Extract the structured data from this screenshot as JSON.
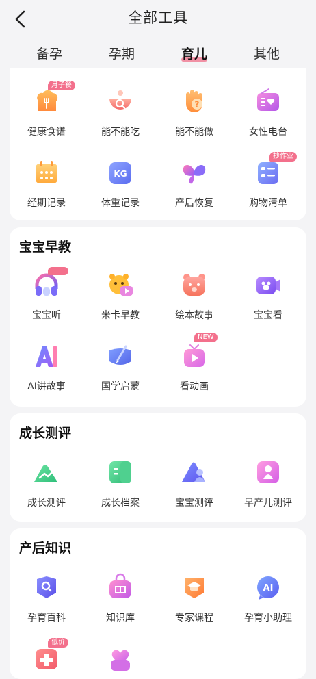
{
  "header": {
    "title": "全部工具"
  },
  "tabs": [
    {
      "label": "备孕"
    },
    {
      "label": "孕期"
    },
    {
      "label": "育儿"
    },
    {
      "label": "其他"
    }
  ],
  "sections": [
    {
      "title": "",
      "items": [
        {
          "label": "健康食谱",
          "icon": "chef-hat-icon",
          "badge": "月子餐"
        },
        {
          "label": "能不能吃",
          "icon": "food-bowl-search-icon"
        },
        {
          "label": "能不能做",
          "icon": "hand-question-icon"
        },
        {
          "label": "女性电台",
          "icon": "radio-heart-icon"
        },
        {
          "label": "经期记录",
          "icon": "calendar-icon"
        },
        {
          "label": "体重记录",
          "icon": "scale-kg-icon",
          "icon_text": "KG"
        },
        {
          "label": "产后恢复",
          "icon": "butterfly-icon"
        },
        {
          "label": "购物清单",
          "icon": "checklist-icon",
          "badge": "抄作业"
        }
      ]
    },
    {
      "title": "宝宝早教",
      "items": [
        {
          "label": "宝宝听",
          "icon": "headphones-icon",
          "badge": ""
        },
        {
          "label": "米卡早教",
          "icon": "bear-video-icon"
        },
        {
          "label": "绘本故事",
          "icon": "bear-book-icon"
        },
        {
          "label": "宝宝看",
          "icon": "video-camera-icon"
        },
        {
          "label": "AI讲故事",
          "icon": "ai-letters-icon"
        },
        {
          "label": "国学启蒙",
          "icon": "scroll-brush-icon"
        },
        {
          "label": "看动画",
          "icon": "tv-play-icon",
          "badge": "NEW"
        }
      ]
    },
    {
      "title": "成长测评",
      "items": [
        {
          "label": "成长测评",
          "icon": "growth-chart-icon"
        },
        {
          "label": "成长档案",
          "icon": "archive-folder-icon"
        },
        {
          "label": "宝宝测评",
          "icon": "baby-triangle-icon"
        },
        {
          "label": "早产儿测评",
          "icon": "premature-baby-icon"
        }
      ]
    },
    {
      "title": "产后知识",
      "items": [
        {
          "label": "孕育百科",
          "icon": "encyclopedia-search-icon"
        },
        {
          "label": "知识库",
          "icon": "book-bag-icon"
        },
        {
          "label": "专家课程",
          "icon": "graduation-cap-icon"
        },
        {
          "label": "孕育小助理",
          "icon": "ai-assistant-icon",
          "icon_text": "AI"
        },
        {
          "label": "",
          "icon": "medical-kit-icon",
          "badge": "低价"
        },
        {
          "label": "",
          "icon": "heart-bag-icon"
        }
      ]
    }
  ],
  "colors": {
    "accent": "#f3708c",
    "background": "#f4f4f6"
  }
}
